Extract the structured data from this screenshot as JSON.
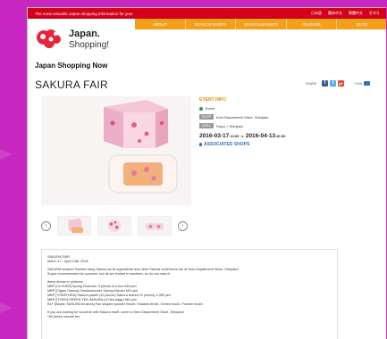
{
  "topbar": {
    "tagline": "The most valuable Japan shopping information for you!",
    "languages": [
      "日本語",
      "簡体中文",
      "繁體中文",
      "한국어"
    ]
  },
  "logo": {
    "title": "Japan.",
    "subtitle": "Shopping!"
  },
  "nav": {
    "items": [
      "ABOUT",
      "SEARCH SHOPS",
      "SEARCH EVENTS",
      "FEATURE",
      "BLOG"
    ]
  },
  "section_title": "Japan Shopping Now",
  "page_title": "SAKURA FAIR",
  "share": {
    "label": "SHARE",
    "buttons": [
      "f",
      "t",
      "g+"
    ],
    "print_label": "Print"
  },
  "event_info": {
    "title": "EVENT INFO",
    "type": "Event",
    "shop_tag": "SHOP",
    "shop": "Keio Department Store, Shinjuku",
    "area_tag": "AREA",
    "area": "Tokyo > Shinjuku",
    "start_date": "2016-03-17",
    "start_time": "10:00",
    "to": "to",
    "end_date": "2016-04-13",
    "end_time": "20:00",
    "associated_shops": "ASSOCIATED SHOPS"
  },
  "thumbnails": {
    "prev": "‹",
    "next": "›"
  },
  "description": {
    "lines": [
      "SAKURA FAIR",
      "March 17 - April 13th, 2016",
      "",
      "SAKURA season! Sweets using Sakura as its ingredients and other Sakura motif items are at Keio Department Store, Shinjuku!",
      "Super recommended for souvenir, but all are limited in numbers, so do not miss it!",
      "",
      "Items shown in pictures",
      "MBP   [CLOVER]   Spring Financier   9 pieces in a box   648 yen",
      "MBP   [Cigars Sanwa]   Omoitozenoshi Spring Mizuiro   691 yen",
      "MBP   [TORAYORU]   Sakura pastel (10 pieces)   Sakura leaves 10 pieces)   1,080 yen",
      "MBP   [ITOEN]   GREEN TEA SAKURA   (10 tea bags)   864 yen",
      "B1F [Bioplin SAKURA brushes]   Fan shaped powder Brush, Shadow brush, Cheek brush, Powder brush",
      "",
      "If you are looking for souvenir with Sakura motif, come to Keio Department Store, Shinjuku!",
      "*All prices include tax."
    ]
  },
  "colors": {
    "topbar": "#d3001b",
    "nav": "#f2a01a",
    "accent_blue": "#3b6fb0",
    "event_info_orange": "#e78a00",
    "frame_outer": "#c826c0"
  }
}
